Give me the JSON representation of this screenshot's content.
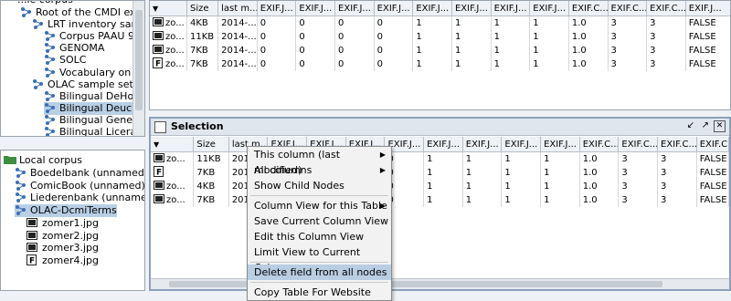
{
  "tree_top": {
    "partial_first": "...le corpus",
    "items": [
      {
        "label": "Root of the CMDI examp",
        "level": 1,
        "icon": "node-icon"
      },
      {
        "label": "LRT inventory sampl",
        "level": 2,
        "icon": "node-icon"
      },
      {
        "label": "Corpus PAAU 92",
        "level": 3,
        "icon": "node-icon"
      },
      {
        "label": "GENOMA",
        "level": 3,
        "icon": "node-icon"
      },
      {
        "label": "SOLC",
        "level": 3,
        "icon": "node-icon"
      },
      {
        "label": "Vocabulary on we",
        "level": 3,
        "icon": "node-icon"
      },
      {
        "label": "OLAC sample set",
        "level": 2,
        "icon": "node-icon"
      },
      {
        "label": "Bilingual DeHouw",
        "level": 3,
        "icon": "node-icon"
      },
      {
        "label": "Bilingual Deucha",
        "level": 3,
        "icon": "node-icon",
        "selected": true
      },
      {
        "label": "Bilingual Genese",
        "level": 3,
        "icon": "node-icon"
      },
      {
        "label": "Bilingual Liceras",
        "level": 3,
        "icon": "node-icon"
      }
    ]
  },
  "tree_local": {
    "root": "Local corpus",
    "items": [
      {
        "label": "Boedelbank (unnamed)",
        "level": 1
      },
      {
        "label": "ComicBook (unnamed)",
        "level": 1
      },
      {
        "label": "Liederenbank (unnamed)",
        "level": 1
      },
      {
        "label": "OLAC-DcmiTerms",
        "level": 1,
        "selected": true
      },
      {
        "label": "zomer1.jpg",
        "level": 2,
        "icon": "film-icon"
      },
      {
        "label": "zomer2.jpg",
        "level": 2,
        "icon": "film-icon"
      },
      {
        "label": "zomer3.jpg",
        "level": 2,
        "icon": "film-icon"
      },
      {
        "label": "zomer4.jpg",
        "level": 2,
        "icon": "file-f-icon"
      }
    ]
  },
  "top_table": {
    "headers": [
      "",
      "Size",
      "last m...",
      "EXIF.J...",
      "EXIF.J...",
      "EXIF.J...",
      "EXIF.J...",
      "EXIF.J...",
      "EXIF.J...",
      "EXIF.J...",
      "EXIF.J...",
      "EXIF.C...",
      "EXIF.C...",
      "EXIF.C...",
      "EXIF.J..."
    ],
    "rows": [
      [
        "zo...",
        "4KB",
        "2014-...",
        "0",
        "0",
        "0",
        "0",
        "1",
        "1",
        "1",
        "1",
        "1.0",
        "3",
        "3",
        "FALSE"
      ],
      [
        "zo...",
        "11KB",
        "2014-...",
        "0",
        "0",
        "0",
        "0",
        "1",
        "1",
        "1",
        "1",
        "1.0",
        "3",
        "3",
        "FALSE"
      ],
      [
        "zo...",
        "7KB",
        "2014-...",
        "0",
        "0",
        "0",
        "0",
        "1",
        "1",
        "1",
        "1",
        "1.0",
        "3",
        "3",
        "FALSE"
      ],
      [
        "zo...",
        "7KB",
        "2014-...",
        "0",
        "0",
        "0",
        "0",
        "1",
        "1",
        "1",
        "1",
        "1.0",
        "3",
        "3",
        "FALSE"
      ]
    ]
  },
  "selection_panel": {
    "title": "Selection",
    "headers": [
      "",
      "Size",
      "last m...",
      "EXIF.J...",
      "EXIF.J...",
      "EXIF.J...",
      "EXIF.J...",
      "EXIF.J...",
      "EXIF.J...",
      "EXIF.J...",
      "EXIF.J...",
      "EXIF.C...",
      "EXIF.C...",
      "EXIF.C...",
      "EXIF.C..."
    ],
    "rows": [
      [
        "zo...",
        "11KB",
        "2014",
        "0",
        "0",
        "0",
        "0",
        "1",
        "1",
        "1",
        "1",
        "1.0",
        "3",
        "3",
        "FALSE"
      ],
      [
        "",
        "7KB",
        "2014",
        "0",
        "0",
        "0",
        "0",
        "1",
        "1",
        "1",
        "1",
        "1.0",
        "3",
        "3",
        "FALSE"
      ],
      [
        "zo...",
        "4KB",
        "2014",
        "0",
        "0",
        "0",
        "0",
        "1",
        "1",
        "1",
        "1",
        "1.0",
        "3",
        "3",
        "FALSE"
      ],
      [
        "zo...",
        "7KB",
        "2014",
        "0",
        "0",
        "0",
        "0",
        "1",
        "1",
        "1",
        "1",
        "1.0",
        "3",
        "3",
        "FALSE"
      ]
    ]
  },
  "context_menu": [
    {
      "label": "This column (last modified)",
      "submenu": true
    },
    {
      "label": "All columns",
      "submenu": true
    },
    {
      "label": "Show Child Nodes"
    },
    {
      "separator": true
    },
    {
      "label": "Column View for this Table",
      "submenu": true
    },
    {
      "label": "Save Current Column View"
    },
    {
      "label": "Edit this Column View"
    },
    {
      "label": "Limit View to Current Columns"
    },
    {
      "separator": true
    },
    {
      "label": "Delete field from all nodes",
      "highlighted": true
    },
    {
      "separator": true
    },
    {
      "label": "Copy Table For Website"
    }
  ],
  "colors": {
    "selection": "#b8cfe5",
    "menu_highlight": "#b9cde3",
    "folder": "#3e8e3e"
  }
}
